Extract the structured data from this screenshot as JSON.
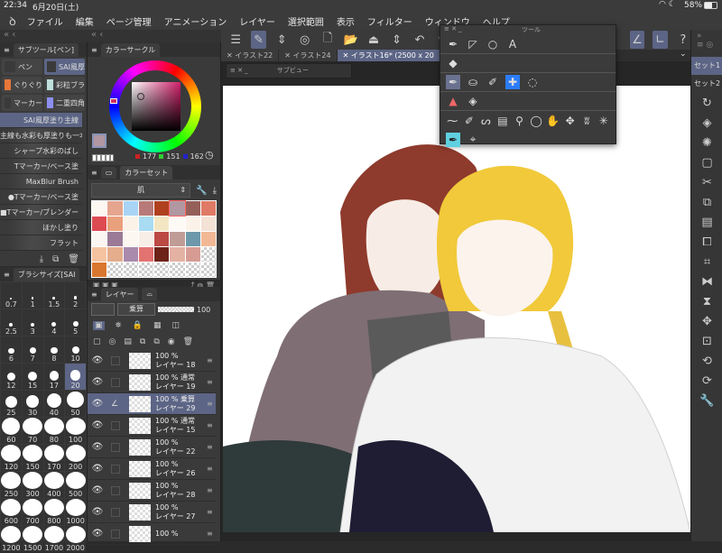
{
  "status": {
    "time": "22:34",
    "date": "6月20日(土)",
    "battery": "58%"
  },
  "menu": [
    "ファイル",
    "編集",
    "ページ管理",
    "アニメーション",
    "レイヤー",
    "選択範囲",
    "表示",
    "フィルター",
    "ウィンドウ",
    "ヘルプ"
  ],
  "subtool": {
    "title": "サブツール[ペン]",
    "groups": [
      "ペン",
      "SAI風厚",
      "ぐりぐり",
      "彩粒ブラ",
      "マーカー",
      "二重四角"
    ],
    "brushes": [
      "SAI風厚塗り主線",
      "主線も水彩も厚塗りも一本",
      "シャープ水彩のばし",
      "Tマーカー/ベース塗",
      "MaxBlur Brush",
      "●Tマーカー/ベース塗",
      "■Tマーカー/ブレンダー",
      "ほかし塗り",
      "フラット"
    ]
  },
  "brush_size": {
    "title": "ブラシサイズ[SAI",
    "sizes": [
      "0.7",
      "1",
      "1.5",
      "2",
      "2.5",
      "3",
      "4",
      "5",
      "6",
      "7",
      "8",
      "10",
      "12",
      "15",
      "17",
      "20",
      "25",
      "30",
      "40",
      "50",
      "60",
      "70",
      "80",
      "100",
      "120",
      "150",
      "170",
      "200",
      "250",
      "300",
      "400",
      "500",
      "600",
      "700",
      "800",
      "1000",
      "1200",
      "1500",
      "1700",
      "2000"
    ],
    "selected": "20"
  },
  "color_circle": {
    "title": "カラーサークル",
    "r": "177",
    "g": "151",
    "b": "162",
    "main_color": "#b197a2",
    "sub_color": "#d8ecf6"
  },
  "color_set": {
    "title": "カラーセット",
    "set_name": "肌",
    "swatches": [
      "#fdf7f2",
      "#e5a58f",
      "#a8d4f5",
      "#b87a78",
      "#b0401e",
      "#b097a2",
      "#96605a",
      "#df7a66",
      "#dd4b52",
      "#e9a07c",
      "#fbf2e8",
      "#a9dcf3",
      "#f3e6c3",
      "#fdf9f4",
      "#fbf3ea",
      "#f4e2d6",
      "#fbf6f1",
      "#9a7a96",
      "#fcf7f1",
      "#f7efe7",
      "#bb4a44",
      "#c09c97",
      "#6d98aa",
      "#f2b895",
      "#f5c3a0",
      "#e4ad8c",
      "#a98aad",
      "#e37371",
      "#6e2318",
      "#e4b2a3",
      "#d69c94",
      "checker",
      "#d9762f",
      "checker",
      "checker",
      "checker",
      "checker",
      "checker",
      "checker",
      "checker"
    ]
  },
  "layers": {
    "title": "レイヤー",
    "blend_mode": "乗算",
    "opacity": "100",
    "items": [
      {
        "opacity": "100 %",
        "mode": "",
        "name": "レイヤー 18"
      },
      {
        "opacity": "100 %",
        "mode": "通常",
        "name": "レイヤー 19"
      },
      {
        "opacity": "100 %",
        "mode": "乗算",
        "name": "レイヤー 29",
        "selected": true
      },
      {
        "opacity": "100 %",
        "mode": "通常",
        "name": "レイヤー 15"
      },
      {
        "opacity": "100 %",
        "mode": "",
        "name": "レイヤー 22"
      },
      {
        "opacity": "100 %",
        "mode": "",
        "name": "レイヤー 26"
      },
      {
        "opacity": "100 %",
        "mode": "",
        "name": "レイヤー 28"
      },
      {
        "opacity": "100 %",
        "mode": "",
        "name": "レイヤー 27"
      },
      {
        "opacity": "100 %",
        "mode": "",
        "name": ""
      }
    ]
  },
  "tabs": [
    "イラスト22",
    "イラスト24",
    "イラスト16* (2500 x 20"
  ],
  "subview": {
    "title": "サブビュー"
  },
  "tool_popup": {
    "title": "ツール"
  },
  "right_sets": [
    "セット1",
    "セット2"
  ]
}
